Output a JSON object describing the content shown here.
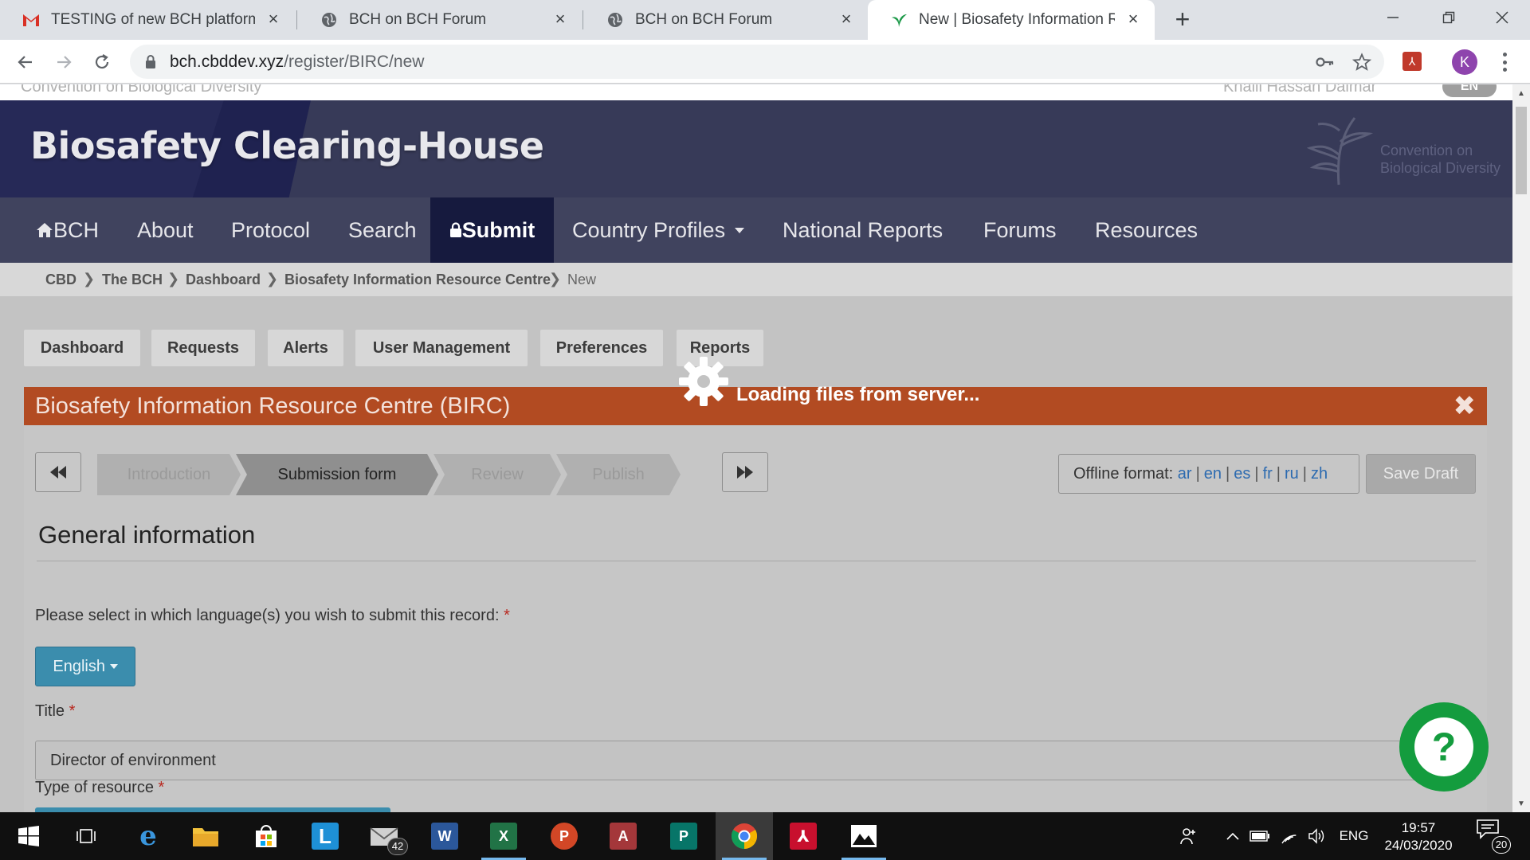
{
  "browser": {
    "tabs": [
      {
        "title": "TESTING of new BCH platform - I",
        "icon": "gmail-icon"
      },
      {
        "title": "BCH on BCH Forum",
        "icon": "globe-icon"
      },
      {
        "title": "BCH on BCH Forum",
        "icon": "globe-icon"
      },
      {
        "title": "New | Biosafety Information Reso",
        "icon": "leaf-icon",
        "active": true
      }
    ],
    "url_host": "bch.cbddev.xyz",
    "url_path": "/register/BIRC/new",
    "profile_initial": "K"
  },
  "page": {
    "top_strip": {
      "org_name": "Convention on Biological Diversity",
      "user_name": "Khalil Hassan Dalmar",
      "lang": "EN"
    },
    "site_title": "Biosafety Clearing-House",
    "cbd_logo_text": "Convention on\nBiological Diversity",
    "nav": {
      "home": "BCH",
      "about": "About",
      "protocol": "Protocol",
      "search": "Search",
      "submit": "Submit",
      "country_profiles": "Country Profiles",
      "national_reports": "National Reports",
      "forums": "Forums",
      "resources": "Resources"
    },
    "breadcrumb": [
      "CBD",
      "The BCH",
      "Dashboard",
      "Biosafety Information Resource Centre",
      "New"
    ],
    "subnav": [
      "Dashboard",
      "Requests",
      "Alerts",
      "User Management",
      "Preferences",
      "Reports"
    ],
    "loading_text": "Loading files from server...",
    "panel_title": "Biosafety Information Resource Centre (BIRC)",
    "wizard_steps": [
      "Introduction",
      "Submission form",
      "Review",
      "Publish"
    ],
    "offline": {
      "label": "Offline format:",
      "langs": [
        "ar",
        "en",
        "es",
        "fr",
        "ru",
        "zh"
      ]
    },
    "save_draft": "Save Draft",
    "section_title": "General information",
    "language_label": "Please select in which language(s) you wish to submit this record:",
    "language_value": "English",
    "title_label": "Title",
    "title_value": "Director of  environment",
    "type_label": "Type of resource",
    "required_mark": "*"
  },
  "taskbar": {
    "mail_badge": "42",
    "lang": "ENG",
    "time": "19:57",
    "date": "24/03/2020",
    "notifications": "20"
  },
  "colors": {
    "banner": "#373a58",
    "nav": "#40435e",
    "nav_active": "#161a3e",
    "panel_header": "#b24b22",
    "primary_button": "#3b8dad",
    "help_bubble": "#149c3e"
  }
}
